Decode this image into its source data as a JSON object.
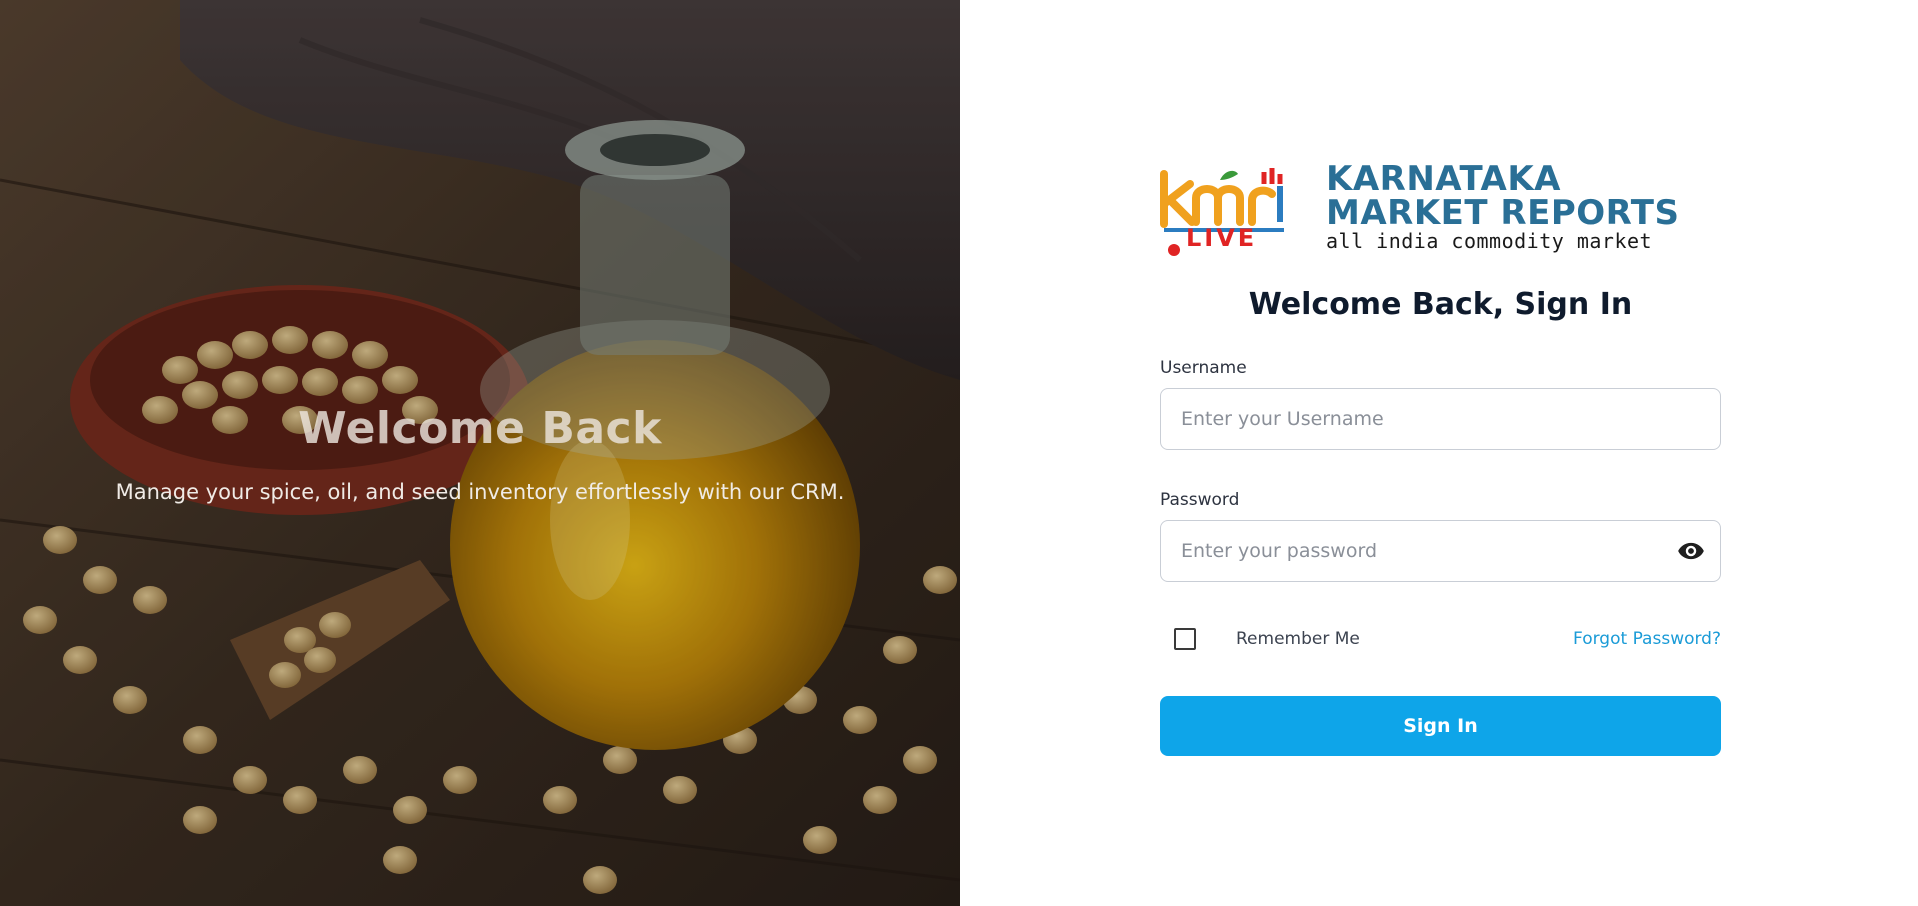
{
  "hero": {
    "title": "Welcome Back",
    "subtitle": "Manage your spice, oil, and seed inventory effortlessly with our CRM."
  },
  "logo": {
    "mark_text": "kmr",
    "live_text": "LIVE",
    "brand_line1": "KARNATAKA",
    "brand_line2": "MARKET REPORTS",
    "brand_tagline": "all india commodity market"
  },
  "form": {
    "title": "Welcome Back, Sign In",
    "username_label": "Username",
    "username_placeholder": "Enter your Username",
    "username_value": "",
    "password_label": "Password",
    "password_placeholder": "Enter your password",
    "password_value": "",
    "remember_label": "Remember Me",
    "remember_checked": false,
    "forgot_label": "Forgot Password?",
    "submit_label": "Sign In"
  },
  "icons": {
    "password_toggle": "eye-icon"
  },
  "colors": {
    "accent": "#0ea5e9",
    "link": "#1a9bd7",
    "brand_blue": "#2a6f96",
    "logo_orange": "#f0a11e",
    "logo_red": "#e02424"
  }
}
